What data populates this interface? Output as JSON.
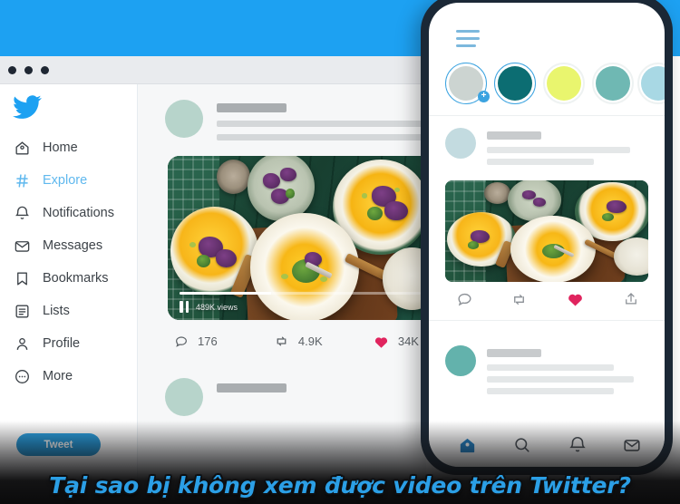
{
  "theme": {
    "twitter_blue": "#1DA1F2",
    "caption_blue": "#2B9FE6",
    "like_pink": "#E0245E",
    "phone_bezel": "#1B2836"
  },
  "top_band": {
    "name": "blue-header-band"
  },
  "browser": {
    "window_controls": [
      "dot-1",
      "dot-2",
      "dot-3"
    ],
    "sidebar": {
      "logo": "twitter-bird-logo",
      "items": [
        {
          "label": "Home",
          "icon": "home-icon",
          "active": false
        },
        {
          "label": "Explore",
          "icon": "hashtag-icon",
          "active": true
        },
        {
          "label": "Notifications",
          "icon": "bell-icon",
          "active": false
        },
        {
          "label": "Messages",
          "icon": "envelope-icon",
          "active": false
        },
        {
          "label": "Bookmarks",
          "icon": "bookmark-icon",
          "active": false
        },
        {
          "label": "Lists",
          "icon": "list-icon",
          "active": false
        },
        {
          "label": "Profile",
          "icon": "person-icon",
          "active": false
        },
        {
          "label": "More",
          "icon": "more-circle-icon",
          "active": false
        }
      ],
      "tweet_button": "Tweet"
    },
    "feed": {
      "post": {
        "avatar": "avatar-placeholder",
        "name_placeholder": "name-skeleton-bar",
        "text_placeholders": [
          "text-skeleton-bar",
          "text-skeleton-bar"
        ],
        "media": {
          "type": "video",
          "alt": "flat-lay of three bowls of pumpkin soup on dark green wood table",
          "views": "489K views",
          "progress_percent": 38,
          "play_state_icon": "pause-icon"
        },
        "actions": [
          {
            "icon": "reply-icon",
            "count": "176"
          },
          {
            "icon": "retweet-icon",
            "count": "4.9K"
          },
          {
            "icon": "heart-icon",
            "count": "34K"
          }
        ]
      },
      "post_partial": {
        "avatar": "avatar-placeholder",
        "name_placeholder": "name-skeleton-bar"
      }
    }
  },
  "phone": {
    "menu_icon": "hamburger-menu-icon",
    "stories": [
      {
        "name": "story-add",
        "fill": "#ccd4d1",
        "ring": true,
        "badge": "+"
      },
      {
        "name": "story-2",
        "fill": "#0c6d72",
        "ring": true,
        "badge": ""
      },
      {
        "name": "story-3",
        "fill": "#e9f56e",
        "ring": false,
        "badge": ""
      },
      {
        "name": "story-4",
        "fill": "#6fb8b3",
        "ring": false,
        "badge": ""
      },
      {
        "name": "story-5",
        "fill": "#a8d8e4",
        "ring": false,
        "badge": ""
      }
    ],
    "post_top": {
      "avatar": "avatar-placeholder",
      "avatar_color": "#c3dbe0"
    },
    "post_media": {
      "alt": "flat-lay of three bowls of pumpkin soup on dark green wood table"
    },
    "post_actions": [
      {
        "icon": "reply-icon",
        "active": false
      },
      {
        "icon": "retweet-icon",
        "active": false
      },
      {
        "icon": "heart-icon",
        "active": true
      },
      {
        "icon": "share-icon",
        "active": false
      }
    ],
    "post_bottom": {
      "avatar": "avatar-placeholder",
      "avatar_color": "#63b2ac"
    },
    "bottom_nav": [
      {
        "icon": "home-icon",
        "active": true
      },
      {
        "icon": "search-icon",
        "active": false
      },
      {
        "icon": "bell-icon",
        "active": false
      },
      {
        "icon": "envelope-icon",
        "active": false
      }
    ]
  },
  "caption": {
    "text": "Tại sao bị không xem được video trên Twitter?"
  }
}
